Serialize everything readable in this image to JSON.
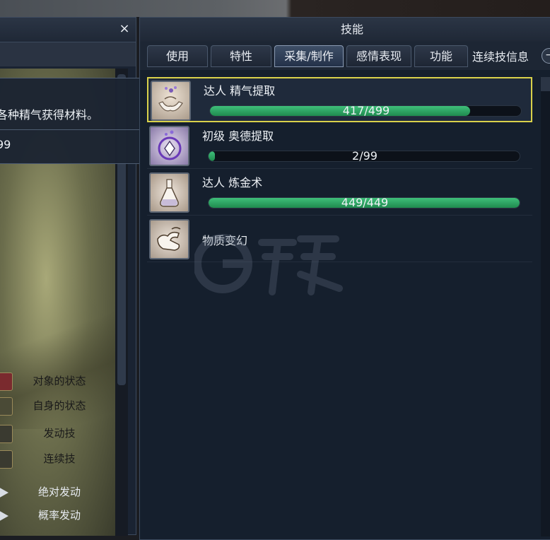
{
  "left_panel": {
    "close_label": "×",
    "legend": [
      {
        "label": "对象的状态",
        "color": "#7a2a2e"
      },
      {
        "label": "自身的状态",
        "color": "#4a4a36"
      },
      {
        "label": "发动技",
        "color": "#3a3a30"
      },
      {
        "label": "连续技",
        "color": "#3a3a30"
      },
      {
        "label": "绝对发动",
        "color": "#d8dde4"
      },
      {
        "label": "概率发动",
        "color": "#d8dde4"
      }
    ]
  },
  "tooltip": {
    "line1": "各种精气获得材料。",
    "line2": "99"
  },
  "skill_panel": {
    "title": "技能",
    "tabs": [
      {
        "label": "使用"
      },
      {
        "label": "特性"
      },
      {
        "label": "采集/制作"
      },
      {
        "label": "感情表现"
      },
      {
        "label": "功能"
      }
    ],
    "active_tab": "采集/制作",
    "extra_tab": "连续技信息",
    "skills": [
      {
        "name": "达人 精气提取",
        "progress_text": "417/499",
        "current": 417,
        "max": 499,
        "icon": "essence-extract-icon"
      },
      {
        "name": "初级 奥德提取",
        "progress_text": "2/99",
        "current": 2,
        "max": 99,
        "icon": "odd-extract-icon"
      },
      {
        "name": "达人 炼金术",
        "progress_text": "449/449",
        "current": 449,
        "max": 449,
        "icon": "alchemy-flask-icon"
      },
      {
        "name": "物质变幻",
        "progress_text": "",
        "icon": "transmute-hand-icon"
      }
    ]
  }
}
